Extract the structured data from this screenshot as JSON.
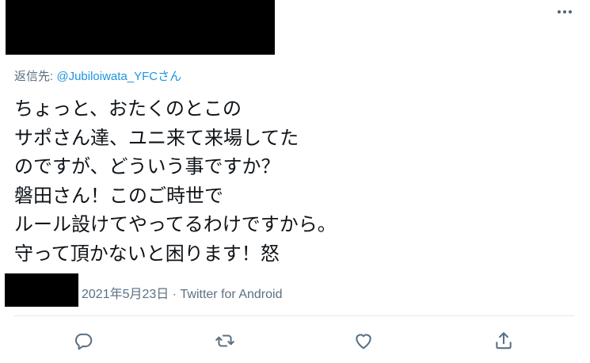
{
  "tweet": {
    "reply_prefix": "返信先: ",
    "reply_handle": "@Jubiloiwata_YFC",
    "reply_suffix": "さん",
    "lines": [
      "ちょっと、おたくのとこの",
      "サポさん達、ユニ来て来場してた",
      "のですが、どういう事ですか？",
      "磐田さん！このご時世で",
      "ルール設けてやってるわけですから。",
      "守って頂かないと困ります！怒"
    ],
    "date": "2021年5月23日",
    "separator": " · ",
    "source": "Twitter for Android"
  },
  "icons": {
    "more": "more-dots-icon",
    "reply": "reply-bubble-icon",
    "retweet": "retweet-icon",
    "like": "heart-icon",
    "share": "share-icon"
  },
  "colors": {
    "text": "#0f1419",
    "secondary": "#5b7083",
    "link": "#1b95e0",
    "divider": "#e1e8ed"
  }
}
